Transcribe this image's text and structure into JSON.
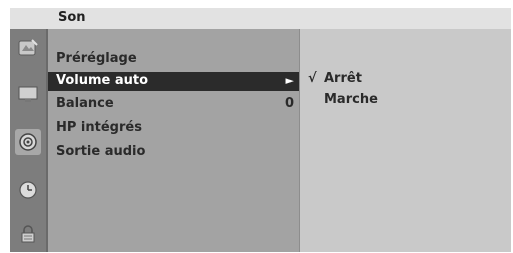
{
  "title": "Son",
  "icons": [
    {
      "name": "picture-icon"
    },
    {
      "name": "screen-icon"
    },
    {
      "name": "sound-icon",
      "active": true
    },
    {
      "name": "time-icon"
    },
    {
      "name": "lock-icon"
    }
  ],
  "menu": {
    "items": [
      {
        "label": "Préréglage",
        "value": ""
      },
      {
        "label": "Volume auto",
        "value": "►",
        "selected": true
      },
      {
        "label": "Balance",
        "value": "0"
      },
      {
        "label": "HP intégrés",
        "value": ""
      },
      {
        "label": "Sortie audio",
        "value": ""
      }
    ]
  },
  "submenu": {
    "items": [
      {
        "check": "√",
        "label": "Arrêt"
      },
      {
        "check": "",
        "label": "Marche"
      }
    ]
  }
}
